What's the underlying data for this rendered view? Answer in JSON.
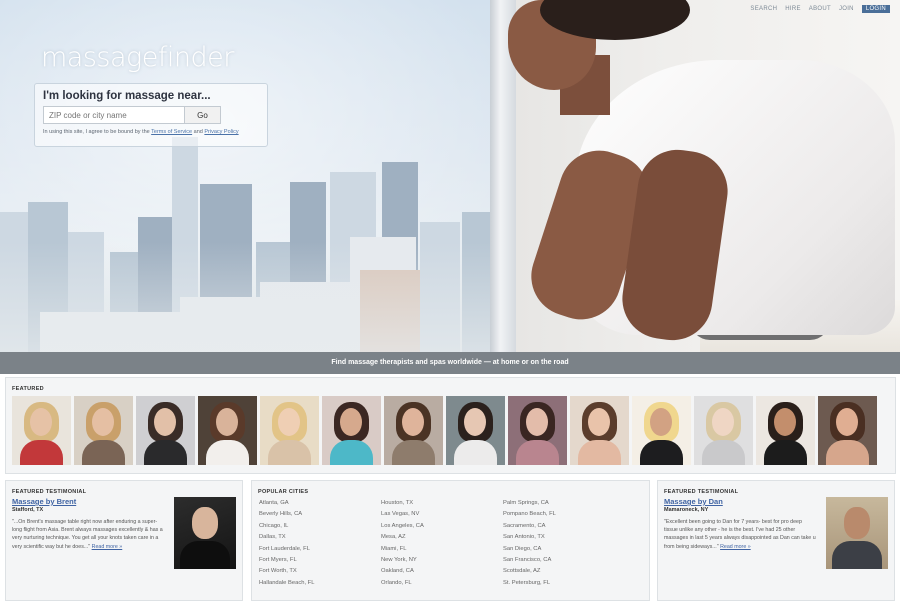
{
  "nav": {
    "search": "SEARCH",
    "hire": "HIRE",
    "about": "ABOUT",
    "join": "JOIN",
    "login": "LOGIN"
  },
  "logo": "massagefinder",
  "search": {
    "title": "I'm looking for massage near...",
    "placeholder": "ZIP code or city name",
    "go_label": "Go",
    "terms_prefix": "In using this site, I agree to be bound by the",
    "terms_link": "Terms of Service",
    "and": "and",
    "privacy_link": "Privacy Policy"
  },
  "banner": "Find massage therapists and spas worldwide — at home or on the road",
  "featured": {
    "label": "FEATURED"
  },
  "testimonial_left": {
    "label": "FEATURED TESTIMONIAL",
    "name": "Massage by Brent",
    "location": "Stafford, TX",
    "text": "\"...On Brent's massage table right now after enduring a super-long flight from Asia. Brent always massages excellently & has a very nurturing technique. You get all your knots taken care in a very scientific way but he does...\"",
    "read_more": "Read more »"
  },
  "popular_cities": {
    "label": "POPULAR CITIES",
    "columns": [
      [
        "Atlanta, GA",
        "Beverly Hills, CA",
        "Chicago, IL",
        "Dallas, TX",
        "Fort Lauderdale, FL",
        "Fort Myers, FL",
        "Fort Worth, TX",
        "Hallandale Beach, FL"
      ],
      [
        "Houston, TX",
        "Las Vegas, NV",
        "Los Angeles, CA",
        "Mesa, AZ",
        "Miami, FL",
        "New York, NY",
        "Oakland, CA",
        "Orlando, FL"
      ],
      [
        "Palm Springs, CA",
        "Pompano Beach, FL",
        "Sacramento, CA",
        "San Antonio, TX",
        "San Diego, CA",
        "San Francisco, CA",
        "Scottsdale, AZ",
        "St. Petersburg, FL"
      ]
    ]
  },
  "testimonial_right": {
    "label": "FEATURED TESTIMONIAL",
    "name": "Massage by Dan",
    "location": "Mamaroneck, NY",
    "text": "\"Excellent been going to Dan for 7 years- best for pro deep tissue unlike any other - he is the best. I've had 25 other massages in last 5 years always disappointed as Dan can take u from being sideways...\"",
    "read_more": "Read more »"
  }
}
